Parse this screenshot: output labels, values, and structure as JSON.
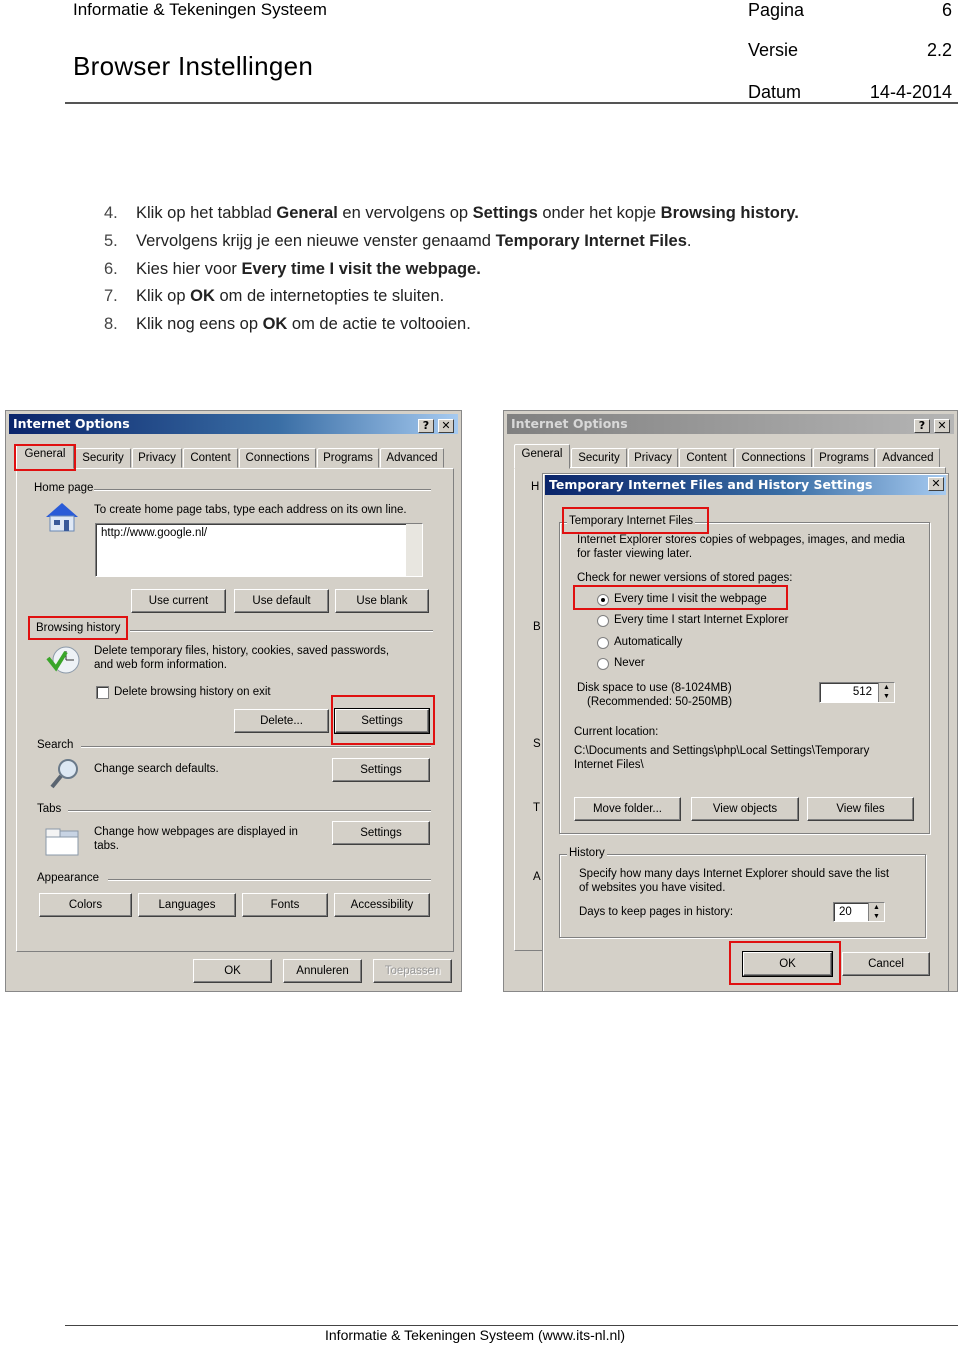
{
  "header": {
    "org": "Informatie & Tekeningen Systeem",
    "title": "Browser Instellingen",
    "meta": [
      {
        "label": "Pagina",
        "value": "6"
      },
      {
        "label": "Versie",
        "value": "2.2"
      },
      {
        "label": "Datum",
        "value": "14-4-2014"
      }
    ]
  },
  "steps": [
    {
      "n": "4.",
      "parts": [
        "Klik op het tabblad ",
        "General",
        " en vervolgens op ",
        "Settings",
        " onder het kopje ",
        "Browsing history."
      ]
    },
    {
      "n": "5.",
      "parts": [
        "Vervolgens krijg je een nieuwe venster genaamd ",
        "Temporary Internet Files",
        "."
      ]
    },
    {
      "n": "6.",
      "parts": [
        "Kies hier voor ",
        "Every time I visit the webpage."
      ]
    },
    {
      "n": "7.",
      "parts": [
        "Klik op ",
        "OK",
        " om de internetopties te sluiten."
      ]
    },
    {
      "n": "8.",
      "parts": [
        "Klik nog eens op ",
        "OK",
        " om de actie te voltooien."
      ]
    }
  ],
  "dialog_left": {
    "title": "Internet Options",
    "help": "?",
    "close": "✕",
    "tabs": [
      "General",
      "Security",
      "Privacy",
      "Content",
      "Connections",
      "Programs",
      "Advanced"
    ],
    "home_page": {
      "label": "Home page",
      "hint": "To create home page tabs, type each address on its own line.",
      "value": "http://www.google.nl/",
      "buttons": [
        "Use current",
        "Use default",
        "Use blank"
      ]
    },
    "browsing_history": {
      "label": "Browsing history",
      "desc1": "Delete temporary files, history, cookies, saved passwords,",
      "desc2": "and web form information.",
      "checkbox": "Delete browsing history on exit",
      "checked": false,
      "delete": "Delete...",
      "settings": "Settings"
    },
    "search": {
      "label": "Search",
      "desc": "Change search defaults.",
      "settings": "Settings"
    },
    "tabs_section": {
      "label": "Tabs",
      "desc1": "Change how webpages are displayed in",
      "desc2": "tabs.",
      "settings": "Settings"
    },
    "appearance": {
      "label": "Appearance",
      "buttons": [
        "Colors",
        "Languages",
        "Fonts",
        "Accessibility"
      ]
    },
    "footer": {
      "ok": "OK",
      "cancel": "Annuleren",
      "apply": "Toepassen"
    }
  },
  "dialog_right": {
    "title": "Internet Options",
    "help": "?",
    "close": "✕",
    "tabs": [
      "General",
      "Security",
      "Privacy",
      "Content",
      "Connections",
      "Programs",
      "Advanced"
    ],
    "bg_letters": [
      "H",
      "B",
      "S",
      "T",
      "A"
    ],
    "sub": {
      "title": "Temporary Internet Files and History Settings",
      "close": "✕",
      "tif_label": "Temporary Internet Files",
      "desc1": "Internet Explorer stores copies of webpages, images, and media",
      "desc2": "for faster viewing later.",
      "check_label": "Check for newer versions of stored pages:",
      "options": [
        "Every time I visit the webpage",
        "Every time I start Internet Explorer",
        "Automatically",
        "Never"
      ],
      "selected": 0,
      "disk1": "Disk space to use (8-1024MB)",
      "disk2": "(Recommended: 50-250MB)",
      "disk_value": "512",
      "loc_label": "Current location:",
      "loc1": "C:\\Documents and Settings\\php\\Local Settings\\Temporary",
      "loc2": "Internet Files\\",
      "buttons": [
        "Move folder...",
        "View objects",
        "View files"
      ],
      "history_label": "History",
      "hist1": "Specify how many days Internet Explorer should save the list",
      "hist2": "of websites you have visited.",
      "days_label": "Days to keep pages in history:",
      "days_value": "20",
      "ok": "OK",
      "cancel": "Cancel"
    }
  },
  "footer": {
    "text": "Informatie & Tekeningen Systeem (www.its-nl.nl)"
  },
  "colors": {
    "highlight": "#e01010",
    "titlebar": "#0a246a",
    "dialog_bg": "#d4d0c8"
  }
}
